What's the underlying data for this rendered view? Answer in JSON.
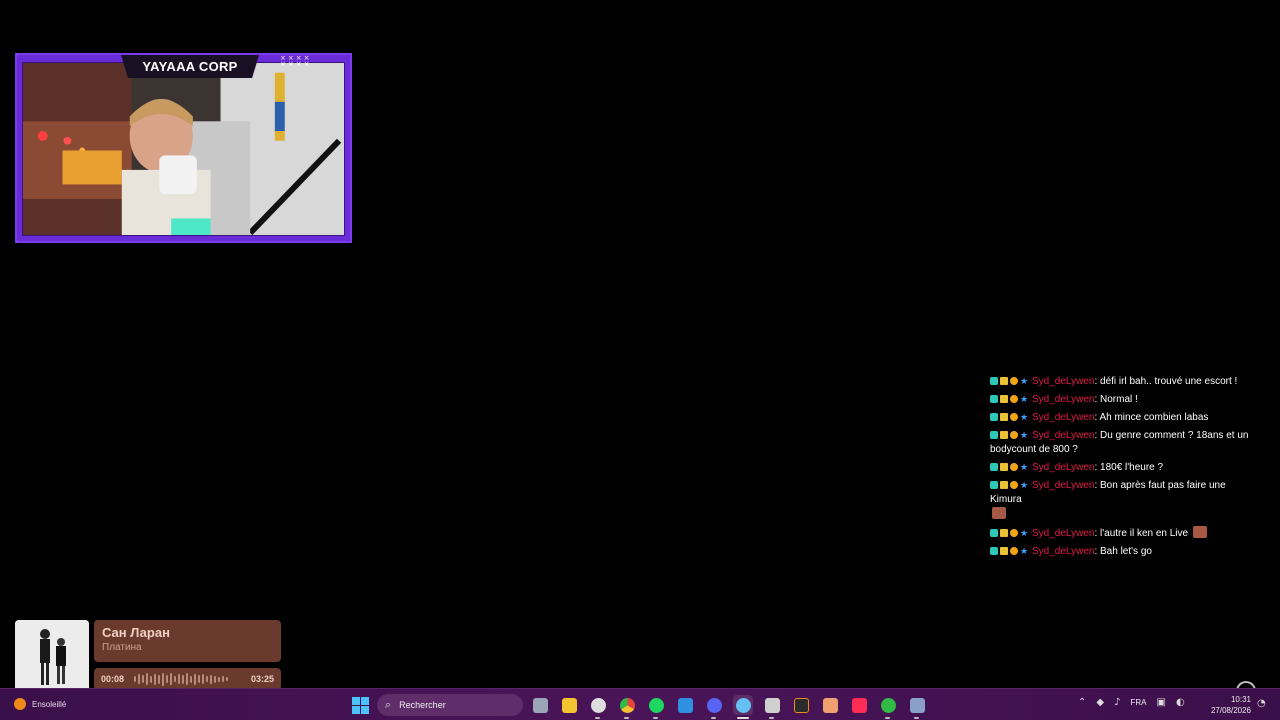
{
  "stream": {
    "cam_title": "YAYAAA CORP",
    "cam_crosses": "× × × ×\n× × × ×"
  },
  "chat": {
    "messages": [
      {
        "user": "Syd_deLywen",
        "text": "défi irl bah.. trouvé une escort !"
      },
      {
        "user": "Syd_deLywen",
        "text": "Normal !"
      },
      {
        "user": "Syd_deLywen",
        "text": "Ah mince combien labas"
      },
      {
        "user": "Syd_deLywen",
        "text": "Du genre comment ? 18ans et un bodycount de 800 ?"
      },
      {
        "user": "Syd_deLywen",
        "text": "180€ l'heure ?"
      },
      {
        "user": "Syd_deLywen",
        "text": "Bon après faut pas faire une Kimura"
      },
      {
        "user": "Syd_deLywen",
        "text": "l'autre il ken en Live"
      },
      {
        "user": "Syd_deLywen",
        "text": "Bah let's go"
      }
    ]
  },
  "music": {
    "title": "Сан Ларан",
    "artist": "Платина",
    "elapsed": "00:08",
    "duration": "03:25"
  },
  "taskbar": {
    "weather_label": "Ensoleillé",
    "search_placeholder": "Rechercher",
    "language": "FRA",
    "time": "10:31",
    "date": "27/08/2026",
    "apps": [
      {
        "name": "task-view",
        "color": "#9aa6b8"
      },
      {
        "name": "file-explorer",
        "color": "#f4c430"
      },
      {
        "name": "obs",
        "color": "#dddddd"
      },
      {
        "name": "chrome",
        "color": "#e8453c"
      },
      {
        "name": "spotify",
        "color": "#1ed760"
      },
      {
        "name": "vscode",
        "color": "#2f8fe0"
      },
      {
        "name": "discord",
        "color": "#5865f2"
      },
      {
        "name": "steam",
        "color": "#66c0f4"
      },
      {
        "name": "media-app",
        "color": "#cfcfcf"
      },
      {
        "name": "terminal",
        "color": "#2b2b2b"
      },
      {
        "name": "photo-app",
        "color": "#f0a070"
      },
      {
        "name": "tiktok",
        "color": "#ff2d55"
      },
      {
        "name": "xbox",
        "color": "#2fbb46"
      },
      {
        "name": "steam-2",
        "color": "#8aa0c8"
      }
    ]
  }
}
